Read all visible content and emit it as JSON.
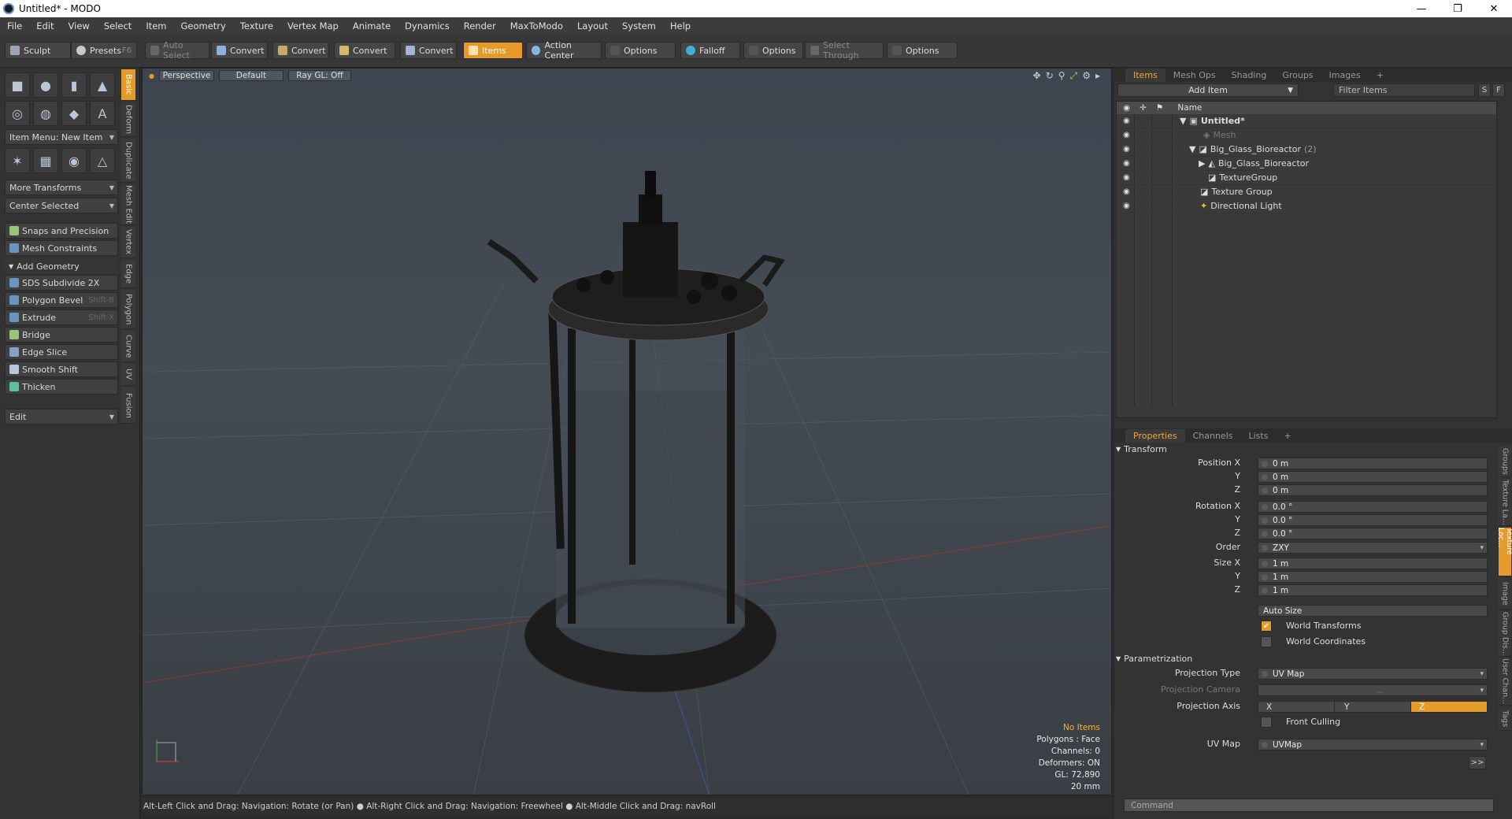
{
  "window": {
    "title": "Untitled* - MODO",
    "min": "—",
    "max": "❐",
    "close": "✕"
  },
  "menu": [
    "File",
    "Edit",
    "View",
    "Select",
    "Item",
    "Geometry",
    "Texture",
    "Vertex Map",
    "Animate",
    "Dynamics",
    "Render",
    "MaxToModo",
    "Layout",
    "System",
    "Help"
  ],
  "toolbar": {
    "sculpt": "Sculpt",
    "presets": "Presets",
    "presets_shortcut": "F6",
    "auto_select": "Auto Select",
    "convert1": "Convert",
    "convert2": "Convert",
    "convert3": "Convert",
    "convert4": "Convert",
    "items": "Items",
    "action_center": "Action Center",
    "options1": "Options",
    "falloff": "Falloff",
    "options2": "Options",
    "select_through": "Select Through",
    "options3": "Options"
  },
  "left": {
    "item_menu": "Item Menu: New Item",
    "more_transforms": "More Transforms",
    "center_selected": "Center Selected",
    "snaps": "Snaps and Precision",
    "mesh_constraints": "Mesh Constraints",
    "add_geometry": "Add Geometry",
    "tools": [
      {
        "label": "SDS Subdivide 2X",
        "shortcut": ""
      },
      {
        "label": "Polygon Bevel",
        "shortcut": "Shift-B"
      },
      {
        "label": "Extrude",
        "shortcut": "Shift-X"
      },
      {
        "label": "Bridge",
        "shortcut": ""
      },
      {
        "label": "Edge Slice",
        "shortcut": ""
      },
      {
        "label": "Smooth Shift",
        "shortcut": ""
      },
      {
        "label": "Thicken",
        "shortcut": ""
      }
    ],
    "edit": "Edit",
    "vtabs": [
      "Basic",
      "Deform",
      "Duplicate",
      "Mesh Edit",
      "Vertex",
      "Edge",
      "Polygon",
      "Curve",
      "UV",
      "Fusion"
    ]
  },
  "viewport": {
    "view": "Perspective",
    "shading": "Default",
    "raygl": "Ray GL: Off",
    "stats": {
      "selection": "No Items",
      "polygons": "Polygons : Face",
      "channels": "Channels: 0",
      "deformers": "Deformers: ON",
      "gl": "GL: 72,890",
      "scale": "20 mm"
    }
  },
  "status": "Alt-Left Click and Drag: Navigation: Rotate (or Pan) ● Alt-Right Click and Drag: Navigation: Freewheel ● Alt-Middle Click and Drag: navRoll",
  "items_panel": {
    "tabs": [
      "Items",
      "Mesh Ops",
      "Shading",
      "Groups",
      "Images"
    ],
    "add_item": "Add Item",
    "filter": "Filter Items",
    "s_btn": "S",
    "f_btn": "F",
    "col_name": "Name",
    "rows": [
      {
        "label": "Untitled*",
        "count": ""
      },
      {
        "label": "Mesh",
        "count": ""
      },
      {
        "label": "Big_Glass_Bioreactor",
        "count": "(2)"
      },
      {
        "label": "Big_Glass_Bioreactor",
        "count": ""
      },
      {
        "label": "TextureGroup",
        "count": ""
      },
      {
        "label": "Texture Group",
        "count": ""
      },
      {
        "label": "Directional Light",
        "count": ""
      }
    ]
  },
  "props_panel": {
    "tabs": [
      "Properties",
      "Channels",
      "Lists"
    ],
    "transform": "Transform",
    "position_x_label": "Position X",
    "position_x": "0 m",
    "y_label": "Y",
    "z_label": "Z",
    "position_y": "0 m",
    "position_z": "0 m",
    "rotation_x_label": "Rotation X",
    "rotation_x": "0.0 °",
    "rotation_y": "0.0 °",
    "rotation_z": "0.0 °",
    "order_label": "Order",
    "order": "ZXY",
    "size_x_label": "Size X",
    "size_x": "1 m",
    "size_y": "1 m",
    "size_z": "1 m",
    "auto_size": "Auto Size",
    "world_transforms": "World Transforms",
    "world_coordinates": "World Coordinates",
    "parametrization": "Parametrization",
    "projection_type_label": "Projection Type",
    "projection_type": "UV Map",
    "projection_camera_label": "Projection Camera",
    "projection_camera": "...",
    "projection_axis_label": "Projection Axis",
    "axis_x": "X",
    "axis_y": "Y",
    "axis_z": "Z",
    "front_culling": "Front Culling",
    "uvmap_label": "UV Map",
    "uvmap": "UVMap",
    "more": ">>",
    "vtabs": [
      "Groups",
      "Texture La...",
      "Texture Loc...",
      "Image",
      "Group Dis...",
      "User Chan...",
      "Tags"
    ],
    "command": "Command"
  },
  "colors": {
    "accent": "#e59b2c"
  }
}
